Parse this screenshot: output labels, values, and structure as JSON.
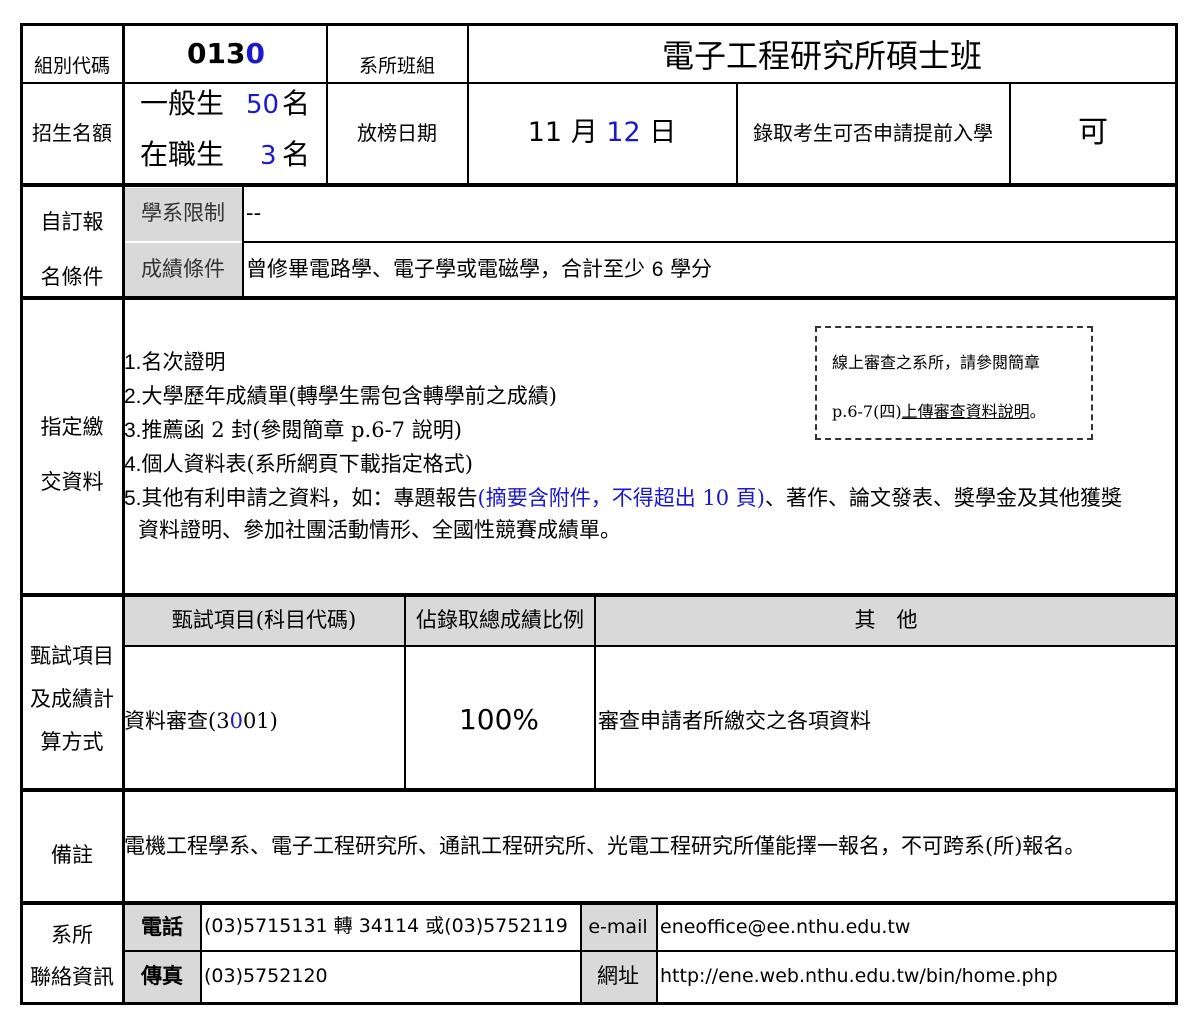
{
  "header": {
    "group_code_label": "組別代碼",
    "group_code_prefix": "013",
    "group_code_suffix": "0",
    "dept_label": "系所班組",
    "dept_value": "電子工程研究所碩士班"
  },
  "quota": {
    "label": "招生名額",
    "general_label": "一般生",
    "general_count": "50",
    "general_unit": "名",
    "working_label": "在職生",
    "working_count": "3",
    "working_unit": "名",
    "release_label": "放榜日期",
    "release_month": "11",
    "release_month_unit": "月",
    "release_day": "12",
    "release_day_unit": "日",
    "early_label": "錄取考生可否申請提前入學",
    "early_value": "可"
  },
  "requirements": {
    "label_line1": "自訂報",
    "label_line2": "名條件",
    "restrict_label": "學系限制",
    "restrict_value": "--",
    "score_label": "成績條件",
    "score_value_a": "曾修畢電路學、電子學或電磁學，合計至少",
    "score_value_num": "6",
    "score_value_b": "學分"
  },
  "documents": {
    "label_line1": "指定繳",
    "label_line2": "交資料",
    "items": [
      {
        "num": "1.",
        "text": "名次證明"
      },
      {
        "num": "2.",
        "text": "大學歷年成績單(轉學生需包含轉學前之成績)"
      },
      {
        "num": "3.",
        "text": "推薦函 2 封(參閱簡章 p.6-7 說明)"
      },
      {
        "num": "4.",
        "text": "個人資料表(系所網頁下載指定格式)"
      }
    ],
    "item5_num": "5.",
    "item5_a": "其他有利申請之資料，如：專題報告",
    "item5_blue": "(摘要含附件，不得超出 10 頁)",
    "item5_b": "、著作、論文發表、獎學金及其他獲獎",
    "item5_line2": "資料證明、參加社團活動情形、全國性競賽成績單。",
    "note_line1": "線上審查之系所，請參閱簡章",
    "note_line2_a": "p.6-7(四)",
    "note_line2_link": "上傳審查資料說明",
    "note_line2_b": "。"
  },
  "exam": {
    "label_line1": "甄試項目",
    "label_line2": "及成績計",
    "label_line3": "算方式",
    "col1_header": "甄試項目(科目代碼)",
    "col2_header": "佔錄取總成績比例",
    "col3_header": "其　他",
    "item_a": "資料審查(3",
    "item_blue": "0",
    "item_b": "01)",
    "ratio": "100%",
    "other": "審查申請者所繳交之各項資料"
  },
  "remarks": {
    "label": "備註",
    "text": "電機工程學系、電子工程研究所、通訊工程研究所、光電工程研究所僅能擇一報名，不可跨系(所)報名。"
  },
  "contact": {
    "label_line1": "系所",
    "label_line2": "聯絡資訊",
    "phone_label": "電話",
    "phone_value": "(03)5715131 轉 34114 或(03)5752119",
    "fax_label": "傳真",
    "fax_value": "(03)5752120",
    "email_label": "e-mail",
    "email_value": "eneoffice@ee.nthu.edu.tw",
    "web_label": "網址",
    "web_value": "http://ene.web.nthu.edu.tw/bin/home.php"
  }
}
